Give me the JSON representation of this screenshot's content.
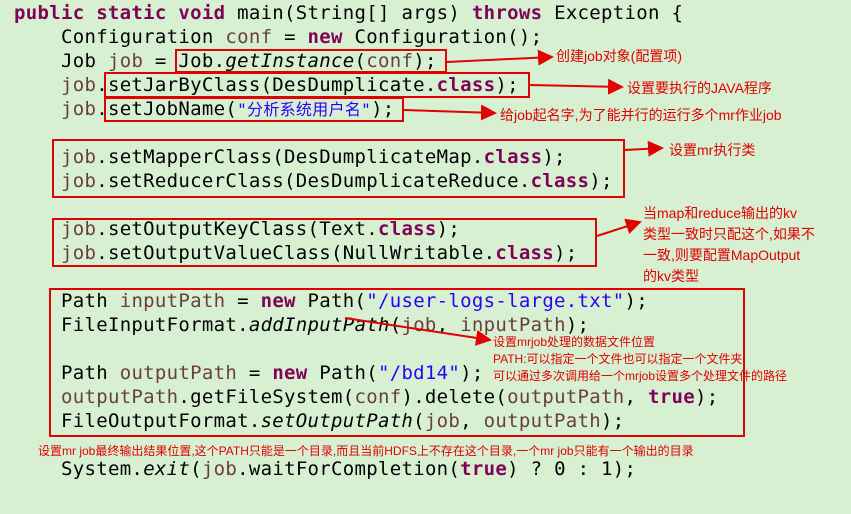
{
  "code": {
    "l1": [
      "public",
      "static",
      "void",
      "main(String[] args)",
      "throws",
      "Exception {"
    ],
    "l2": [
      "Configuration",
      "conf",
      " = ",
      "new",
      " Configuration();"
    ],
    "l3": [
      "Job ",
      "job",
      " = ",
      "Job.",
      "getInstance",
      "(",
      "conf",
      ");"
    ],
    "l4": [
      "job",
      ".setJarByClass(DesDumplicate.",
      "class",
      ");"
    ],
    "l5": [
      "job",
      ".setJobName(",
      "\"分析系统用户名\"",
      ");"
    ],
    "l6": [
      "job",
      ".setMapperClass(DesDumplicateMap.",
      "class",
      ");"
    ],
    "l7": [
      "job",
      ".setReducerClass(DesDumplicateReduce.",
      "class",
      ");"
    ],
    "l8": [
      "job",
      ".setOutputKeyClass(Text.",
      "class",
      ");"
    ],
    "l9": [
      "job",
      ".setOutputValueClass(NullWritable.",
      "class",
      ");"
    ],
    "l10": [
      "Path ",
      "inputPath",
      " = ",
      "new",
      " Path(",
      "\"/user-logs-large.txt\"",
      ");"
    ],
    "l11": [
      "FileInputFormat.",
      "addInputPath",
      "(",
      "job",
      ", ",
      "inputPath",
      ");"
    ],
    "l12": [
      "Path ",
      "outputPath",
      " = ",
      "new",
      " Path(",
      "\"/bd14\"",
      ");"
    ],
    "l13": [
      "outputPath",
      ".getFileSystem(",
      "conf",
      ").delete(",
      "outputPath",
      ", ",
      "true",
      ");"
    ],
    "l14": [
      "FileOutputFormat.",
      "setOutputPath",
      "(",
      "job",
      ", ",
      "outputPath",
      ");"
    ],
    "l15": [
      "System.",
      "exit",
      "(",
      "job",
      ".waitForCompletion(",
      "true",
      ") ? 0 : 1);"
    ]
  },
  "annotations": {
    "a1": "创建job对象(配置项)",
    "a2": "设置要执行的JAVA程序",
    "a3": "给job起名字,为了能并行的运行多个mr作业job",
    "a4": "设置mr执行类",
    "a5": [
      "当map和reduce输出的kv",
      "类型一致时只配这个,如果不",
      "一致,则要配置MapOutput",
      "的kv类型"
    ],
    "a6": [
      "设置mrjob处理的数据文件位置",
      "PATH:可以指定一个文件也可以指定一个文件夹",
      "可以通过多次调用给一个mrjob设置多个处理文件的路径"
    ],
    "a7": "设置mr job最终输出结果位置,这个PATH只能是一个目录,而且当前HDFS上不存在这个目录,一个mr job只能有一个输出的目录"
  },
  "colors": {
    "background": "#d7f0d2",
    "keyword": "#7f0055",
    "variable": "#6a3e3e",
    "string": "#2a00ff",
    "annotation": "#e00000"
  }
}
